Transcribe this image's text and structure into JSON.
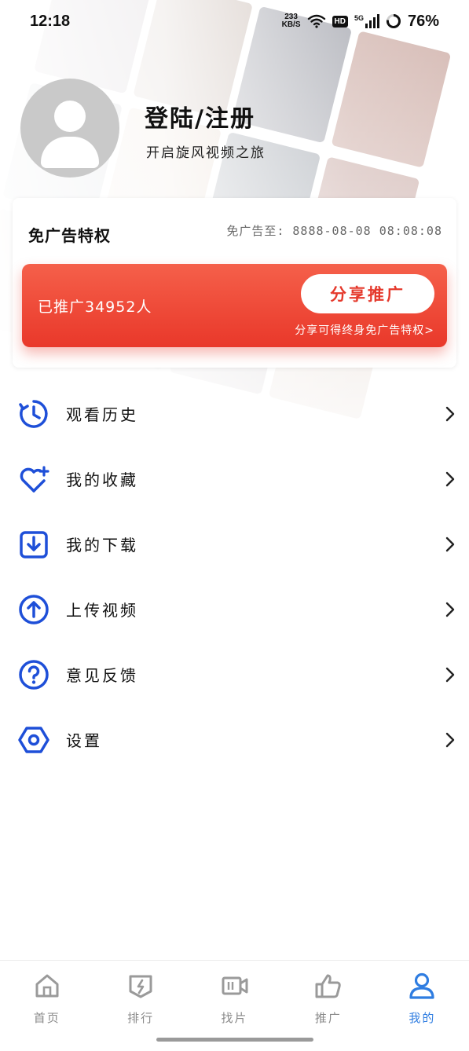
{
  "status_bar": {
    "time": "12:18",
    "net_speed_value": "233",
    "net_speed_unit": "KB/S",
    "hd_badge": "HD",
    "network": "5G",
    "battery": "76%"
  },
  "profile": {
    "title": "登陆/注册",
    "subtitle": "开启旋风视频之旅"
  },
  "privilege_card": {
    "title": "免广告特权",
    "expire": "免广告至: 8888-08-08 08:08:08",
    "promoted_count": "已推广34952人",
    "share_button": "分享推广",
    "share_hint": "分享可得终身免广告特权>"
  },
  "menu": [
    {
      "label": "观看历史",
      "icon": "history-icon"
    },
    {
      "label": "我的收藏",
      "icon": "favorite-heart-icon"
    },
    {
      "label": "我的下载",
      "icon": "download-icon"
    },
    {
      "label": "上传视频",
      "icon": "upload-icon"
    },
    {
      "label": "意见反馈",
      "icon": "help-question-icon"
    },
    {
      "label": "设置",
      "icon": "settings-hex-icon"
    }
  ],
  "bottom_nav": [
    {
      "label": "首页",
      "icon": "home-icon",
      "active": false
    },
    {
      "label": "排行",
      "icon": "ranking-icon",
      "active": false
    },
    {
      "label": "找片",
      "icon": "video-camera-icon",
      "active": false
    },
    {
      "label": "推广",
      "icon": "thumbs-up-icon",
      "active": false
    },
    {
      "label": "我的",
      "icon": "user-icon",
      "active": true
    }
  ],
  "colors": {
    "accent_blue": "#1e4fd8",
    "active_tab": "#2f7de1",
    "promo_red": "#e9382a"
  }
}
